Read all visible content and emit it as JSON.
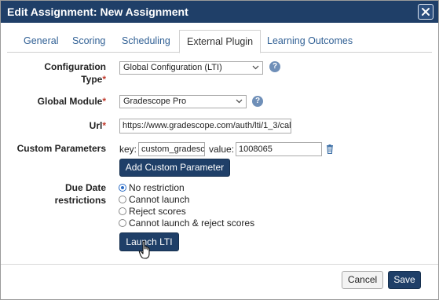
{
  "dialog": {
    "title": "Edit Assignment: New Assignment",
    "close_icon": "close-icon"
  },
  "tabs": [
    {
      "label": "General",
      "active": false
    },
    {
      "label": "Scoring",
      "active": false
    },
    {
      "label": "Scheduling",
      "active": false
    },
    {
      "label": "External Plugin",
      "active": true
    },
    {
      "label": "Learning Outcomes",
      "active": false
    }
  ],
  "form": {
    "configuration_type": {
      "label_line1": "Configuration",
      "label_line2": "Type",
      "required_mark": "*",
      "value": "Global Configuration (LTI)",
      "help": "?"
    },
    "global_module": {
      "label": "Global Module",
      "required_mark": "*",
      "value": "Gradescope Pro",
      "help": "?"
    },
    "url": {
      "label": "Url",
      "required_mark": "*",
      "value": "https://www.gradescope.com/auth/lti/1_3/cal"
    },
    "custom_parameters": {
      "label": "Custom Parameters",
      "key_label": "key:",
      "key_value": "custom_gradesc",
      "value_label": "value:",
      "value_value": "1008065",
      "delete_icon": "trash-icon",
      "add_button": "Add Custom Parameter"
    },
    "due_date": {
      "label_line1": "Due Date",
      "label_line2": "restrictions",
      "options": [
        {
          "label": "No restriction",
          "checked": true
        },
        {
          "label": "Cannot launch",
          "checked": false
        },
        {
          "label": "Reject scores",
          "checked": false
        },
        {
          "label": "Cannot launch & reject scores",
          "checked": false
        }
      ]
    },
    "launch_button": "Launch LTI"
  },
  "footer": {
    "cancel": "Cancel",
    "save": "Save"
  }
}
